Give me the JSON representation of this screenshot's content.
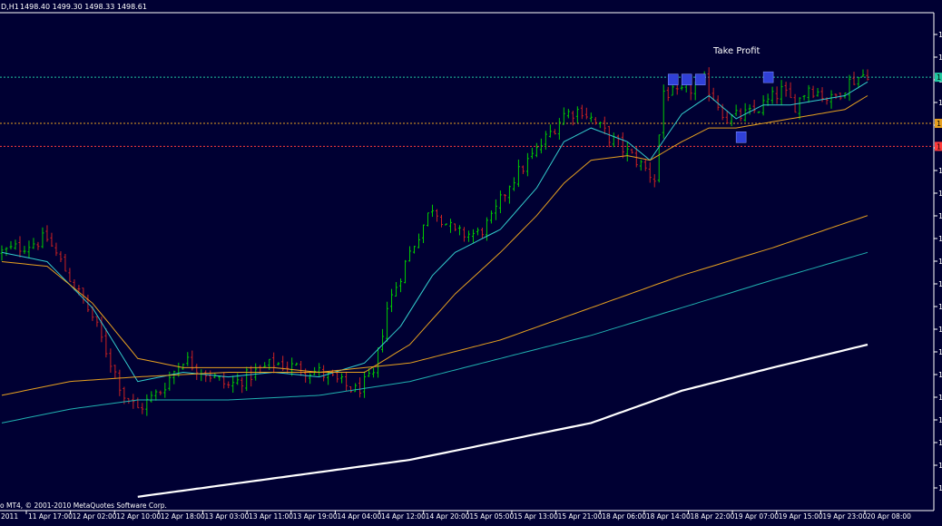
{
  "header": {
    "symbol": "D,H1",
    "ohlc": "1498.40 1499.30 1498.33 1498.61"
  },
  "footer": {
    "copyright": "o MT4, © 2001-2010 MetaQuotes Software Corp.",
    "start_label": "2011"
  },
  "colors": {
    "background": "#000033",
    "bull": "#00cc00",
    "bear": "#cc2222",
    "ma_fast": "#33cccc",
    "ma_slow": "#e6a020",
    "ma_long_orange": "#e6a020",
    "ma_long_teal": "#20b0b0",
    "ma_200": "#ffffff",
    "tp_line": "#20c8a0",
    "entry_line": "#e6a020",
    "stop_line": "#ff3b3b",
    "marker": "#3040d8",
    "text": "#ffffff"
  },
  "price_tags": {
    "take_profit": "1",
    "entry": "1",
    "stop": "1"
  },
  "annotations": {
    "take_profit_label": "Take Profit"
  },
  "chart_data": {
    "type": "candlestick",
    "ylim": [
      0,
      100
    ],
    "time_labels": [
      "11 Apr 17:00",
      "12 Apr 02:00",
      "12 Apr 10:00",
      "12 Apr 18:00",
      "13 Apr 03:00",
      "13 Apr 11:00",
      "13 Apr 19:00",
      "14 Apr 04:00",
      "14 Apr 12:00",
      "14 Apr 20:00",
      "15 Apr 05:00",
      "15 Apr 13:00",
      "15 Apr 21:00",
      "18 Apr 06:00",
      "18 Apr 14:00",
      "18 Apr 22:00",
      "19 Apr 07:00",
      "19 Apr 15:00",
      "19 Apr 23:00",
      "20 Apr 08:00"
    ],
    "price_tick_labels": [
      "1",
      "1",
      "1",
      "1",
      "1",
      "1",
      "1",
      "1",
      "1",
      "1",
      "1",
      "1",
      "1",
      "1",
      "1",
      "1",
      "1",
      "1",
      "1",
      "1",
      "1"
    ],
    "candle_count": 192,
    "close_path": [
      [
        0,
        50
      ],
      [
        10,
        53
      ],
      [
        20,
        36
      ],
      [
        27,
        19
      ],
      [
        30,
        16
      ],
      [
        35,
        20
      ],
      [
        40,
        27
      ],
      [
        50,
        21
      ],
      [
        60,
        26
      ],
      [
        70,
        24
      ],
      [
        78,
        20
      ],
      [
        82,
        23
      ],
      [
        85,
        38
      ],
      [
        90,
        50
      ],
      [
        95,
        60
      ],
      [
        100,
        54
      ],
      [
        105,
        54
      ],
      [
        108,
        57
      ],
      [
        112,
        65
      ],
      [
        118,
        72
      ],
      [
        124,
        80
      ],
      [
        128,
        81
      ],
      [
        134,
        75
      ],
      [
        140,
        70
      ],
      [
        144,
        66
      ],
      [
        146,
        85
      ],
      [
        149,
        84
      ],
      [
        155,
        87
      ],
      [
        160,
        79
      ],
      [
        165,
        80
      ],
      [
        168,
        82
      ],
      [
        172,
        85
      ],
      [
        175,
        82
      ],
      [
        178,
        86
      ],
      [
        183,
        83
      ],
      [
        187,
        87
      ],
      [
        191,
        89
      ]
    ],
    "levels": {
      "take_profit": 88,
      "entry": 78,
      "stop": 73
    },
    "series": [
      {
        "role": "ma_fast",
        "values": [
          [
            0,
            50
          ],
          [
            10,
            48
          ],
          [
            20,
            38
          ],
          [
            30,
            22
          ],
          [
            40,
            24
          ],
          [
            50,
            23
          ],
          [
            60,
            24
          ],
          [
            70,
            23
          ],
          [
            80,
            26
          ],
          [
            88,
            34
          ],
          [
            95,
            45
          ],
          [
            100,
            50
          ],
          [
            110,
            55
          ],
          [
            118,
            64
          ],
          [
            124,
            74
          ],
          [
            130,
            77
          ],
          [
            138,
            74
          ],
          [
            143,
            70
          ],
          [
            150,
            80
          ],
          [
            156,
            84
          ],
          [
            162,
            79
          ],
          [
            168,
            82
          ],
          [
            174,
            82
          ],
          [
            180,
            83
          ],
          [
            186,
            84
          ],
          [
            191,
            87
          ]
        ]
      },
      {
        "role": "ma_slow",
        "values": [
          [
            0,
            48
          ],
          [
            10,
            47
          ],
          [
            20,
            39
          ],
          [
            30,
            27
          ],
          [
            40,
            25
          ],
          [
            50,
            25
          ],
          [
            60,
            25
          ],
          [
            70,
            24
          ],
          [
            80,
            24
          ],
          [
            90,
            30
          ],
          [
            100,
            41
          ],
          [
            110,
            50
          ],
          [
            118,
            58
          ],
          [
            124,
            65
          ],
          [
            130,
            70
          ],
          [
            138,
            71
          ],
          [
            143,
            70
          ],
          [
            150,
            74
          ],
          [
            156,
            77
          ],
          [
            162,
            77
          ],
          [
            168,
            78
          ],
          [
            174,
            79
          ],
          [
            180,
            80
          ],
          [
            186,
            81
          ],
          [
            191,
            84
          ]
        ]
      },
      {
        "role": "ma_long_orange",
        "values": [
          [
            0,
            19
          ],
          [
            15,
            22
          ],
          [
            30,
            23
          ],
          [
            50,
            24
          ],
          [
            70,
            24
          ],
          [
            90,
            26
          ],
          [
            110,
            31
          ],
          [
            130,
            38
          ],
          [
            150,
            45
          ],
          [
            170,
            51
          ],
          [
            191,
            58
          ]
        ]
      },
      {
        "role": "ma_long_teal",
        "values": [
          [
            0,
            13
          ],
          [
            15,
            16
          ],
          [
            30,
            18
          ],
          [
            50,
            18
          ],
          [
            70,
            19
          ],
          [
            90,
            22
          ],
          [
            110,
            27
          ],
          [
            130,
            32
          ],
          [
            150,
            38
          ],
          [
            170,
            44
          ],
          [
            191,
            50
          ]
        ]
      },
      {
        "role": "ma_200",
        "values": [
          [
            30,
            -3
          ],
          [
            60,
            1
          ],
          [
            90,
            5
          ],
          [
            110,
            9
          ],
          [
            130,
            13
          ],
          [
            150,
            20
          ],
          [
            170,
            25
          ],
          [
            191,
            30
          ]
        ]
      }
    ],
    "markers": [
      {
        "i": 148,
        "v": 87.5
      },
      {
        "i": 151,
        "v": 87.5
      },
      {
        "i": 154,
        "v": 87.5
      },
      {
        "i": 163,
        "v": 75
      },
      {
        "i": 169,
        "v": 88
      }
    ],
    "grid": false
  }
}
